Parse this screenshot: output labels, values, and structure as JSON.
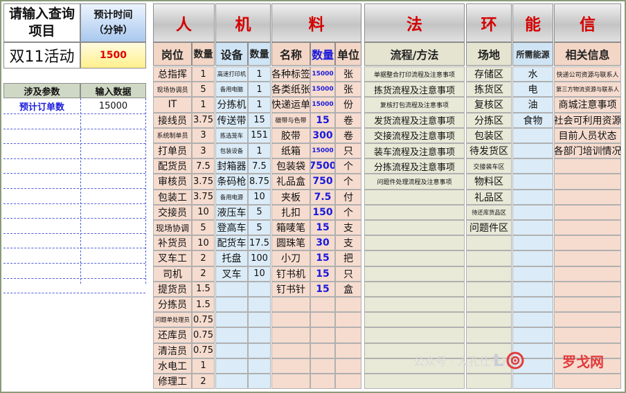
{
  "query": {
    "prompt": "请输入查询项目",
    "time_label": "预计时间（分钟）",
    "project": "双11活动",
    "time_value": "1500",
    "param_header": "涉及参数",
    "input_header": "输入数据",
    "param_name": "预计订单数",
    "param_value": "15000"
  },
  "sections": {
    "ren": "人",
    "ji": "机",
    "liao": "料",
    "fa": "法",
    "huan": "环",
    "neng": "能",
    "xin": "信"
  },
  "headers": {
    "position": "岗位",
    "count1": "数量",
    "equipment": "设备",
    "count2": "数量",
    "name": "名称",
    "count3": "数量",
    "unit": "单位",
    "process": "流程/方法",
    "site": "场地",
    "energy": "所需能源",
    "info": "相关信息"
  },
  "ren_rows": [
    {
      "pos": "总指挥",
      "qty": "1"
    },
    {
      "pos": "现场协调员",
      "qty": "5"
    },
    {
      "pos": "IT",
      "qty": "1"
    },
    {
      "pos": "接线员",
      "qty": "3.75"
    },
    {
      "pos": "系统制单员",
      "qty": "3"
    },
    {
      "pos": "打单员",
      "qty": "3"
    },
    {
      "pos": "配货员",
      "qty": "7.5"
    },
    {
      "pos": "审核员",
      "qty": "3.75"
    },
    {
      "pos": "包装工",
      "qty": "3.75"
    },
    {
      "pos": "交接员",
      "qty": "10"
    },
    {
      "pos": "现场协调",
      "qty": "5"
    },
    {
      "pos": "补货员",
      "qty": "10"
    },
    {
      "pos": "叉车工",
      "qty": "2"
    },
    {
      "pos": "司机",
      "qty": "2"
    },
    {
      "pos": "提货员",
      "qty": "1.5"
    },
    {
      "pos": "分拣员",
      "qty": "1.5"
    },
    {
      "pos": "问题单处理员",
      "qty": "0.75"
    },
    {
      "pos": "还库员",
      "qty": "0.75"
    },
    {
      "pos": "清洁员",
      "qty": "0.75"
    },
    {
      "pos": "水电工",
      "qty": "1"
    },
    {
      "pos": "修理工",
      "qty": "2"
    }
  ],
  "ji_rows": [
    {
      "eq": "高速打印机",
      "qty": "1"
    },
    {
      "eq": "备用电脑",
      "qty": "1"
    },
    {
      "eq": "分拣机",
      "qty": "1"
    },
    {
      "eq": "传送带",
      "qty": "15"
    },
    {
      "eq": "拣选笼车",
      "qty": "151"
    },
    {
      "eq": "包装设备",
      "qty": "1"
    },
    {
      "eq": "封箱器",
      "qty": "7.5"
    },
    {
      "eq": "条码枪",
      "qty": "8.75"
    },
    {
      "eq": "备用电源",
      "qty": "10"
    },
    {
      "eq": "液压车",
      "qty": "5"
    },
    {
      "eq": "登高车",
      "qty": "5"
    },
    {
      "eq": "配货车",
      "qty": "17.5"
    },
    {
      "eq": "托盘",
      "qty": "100"
    },
    {
      "eq": "叉车",
      "qty": "10"
    }
  ],
  "liao_rows": [
    {
      "name": "各种标签",
      "qty": "15000",
      "unit": "张"
    },
    {
      "name": "各类纸张",
      "qty": "15000",
      "unit": "张"
    },
    {
      "name": "快递运单",
      "qty": "15000",
      "unit": "份"
    },
    {
      "name": "碳带与色带",
      "qty": "15",
      "unit": "卷"
    },
    {
      "name": "胶带",
      "qty": "300",
      "unit": "卷"
    },
    {
      "name": "纸箱",
      "qty": "15000",
      "unit": "只"
    },
    {
      "name": "包装袋",
      "qty": "7500",
      "unit": "个"
    },
    {
      "name": "礼品盒",
      "qty": "750",
      "unit": "个"
    },
    {
      "name": "夹板",
      "qty": "7.5",
      "unit": "付"
    },
    {
      "name": "扎扣",
      "qty": "150",
      "unit": "个"
    },
    {
      "name": "箱唛笔",
      "qty": "15",
      "unit": "支"
    },
    {
      "name": "圆珠笔",
      "qty": "30",
      "unit": "支"
    },
    {
      "name": "小刀",
      "qty": "15",
      "unit": "把"
    },
    {
      "name": "钉书机",
      "qty": "15",
      "unit": "只"
    },
    {
      "name": "钉书针",
      "qty": "15",
      "unit": "盒"
    }
  ],
  "fa_rows": [
    "单据整合打印流程及注意事项",
    "拣货流程及注意事项",
    "复核打包流程及注意事项",
    "发货流程及注意事项",
    "交接流程及注意事项",
    "装车流程及注意事项",
    "分拣流程及注意事项",
    "问题件处理流程及注意事项"
  ],
  "huan_rows": [
    "存储区",
    "拣货区",
    "复核区",
    "分拣区",
    "包装区",
    "待发货区",
    "交接装车区",
    "物料区",
    "礼品区",
    "待还库货品区",
    "问题件区"
  ],
  "neng_rows": [
    "水",
    "电",
    "油",
    "食物"
  ],
  "xin_rows": [
    "快递公司资源与联系人",
    "第三方物流资源与联系人",
    "商城注意事项",
    "社会可利用资源",
    "目前人员状态",
    "各部门培训情况"
  ],
  "watermark": {
    "wechat": "公众号 · 人孔仕于格物",
    "logo": "罗戈网"
  },
  "colors": {
    "ren": "#f6dccf",
    "ji": "#dbecf8",
    "liao": "#f6dccf",
    "fa": "#e9e9d8",
    "huan": "#e9e9d8",
    "neng": "#dbecf8",
    "xin": "#f6dccf",
    "accent_red": "#d40000",
    "accent_blue": "#1a1adc"
  }
}
